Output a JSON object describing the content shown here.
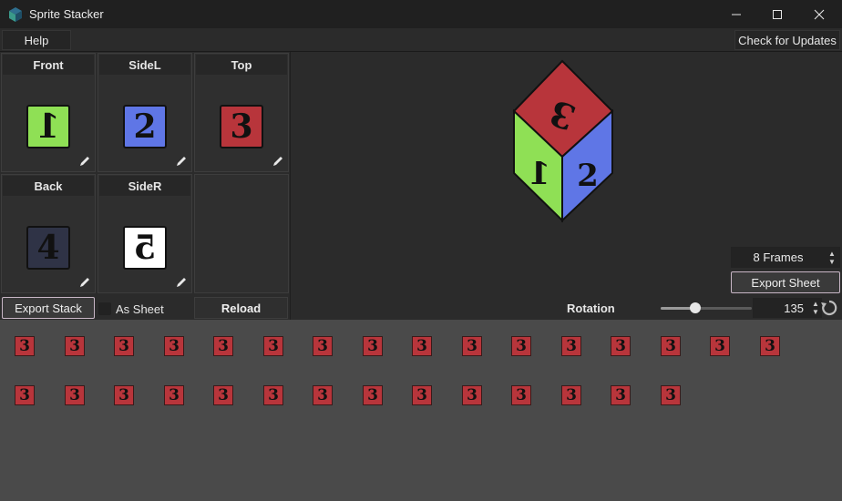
{
  "window": {
    "title": "Sprite Stacker",
    "controls": [
      "minimize",
      "maximize",
      "close"
    ]
  },
  "menu": {
    "help_label": "Help",
    "updates_label": "Check for Updates"
  },
  "faces": [
    {
      "label": "Front",
      "glyph": "1",
      "color": "#8fe055",
      "mirrored": true
    },
    {
      "label": "SideL",
      "glyph": "2",
      "color": "#5f76e6",
      "mirrored": false
    },
    {
      "label": "Top",
      "glyph": "3",
      "color": "#b8353b",
      "mirrored": false
    },
    {
      "label": "Back",
      "glyph": "4",
      "color": "#2f3346",
      "mirrored": false
    },
    {
      "label": "SideR",
      "glyph": "5",
      "color": "#ffffff",
      "mirrored": true
    }
  ],
  "controls": {
    "export_stack_label": "Export Stack",
    "as_sheet_label": "As Sheet",
    "as_sheet_checked": false,
    "reload_label": "Reload"
  },
  "preview": {
    "frames_value": "8 Frames",
    "export_sheet_label": "Export Sheet",
    "rotation_label": "Rotation",
    "rotation_value": "135",
    "rotation_fraction": 0.375
  },
  "frames_strip": {
    "frame_glyph": "3",
    "frame_color": "#b8353b",
    "row1_count": 16,
    "row2_count": 14
  },
  "icons": {
    "app": "app-icon",
    "edit": "pencil-icon",
    "reset": "reset-rotation-icon"
  }
}
